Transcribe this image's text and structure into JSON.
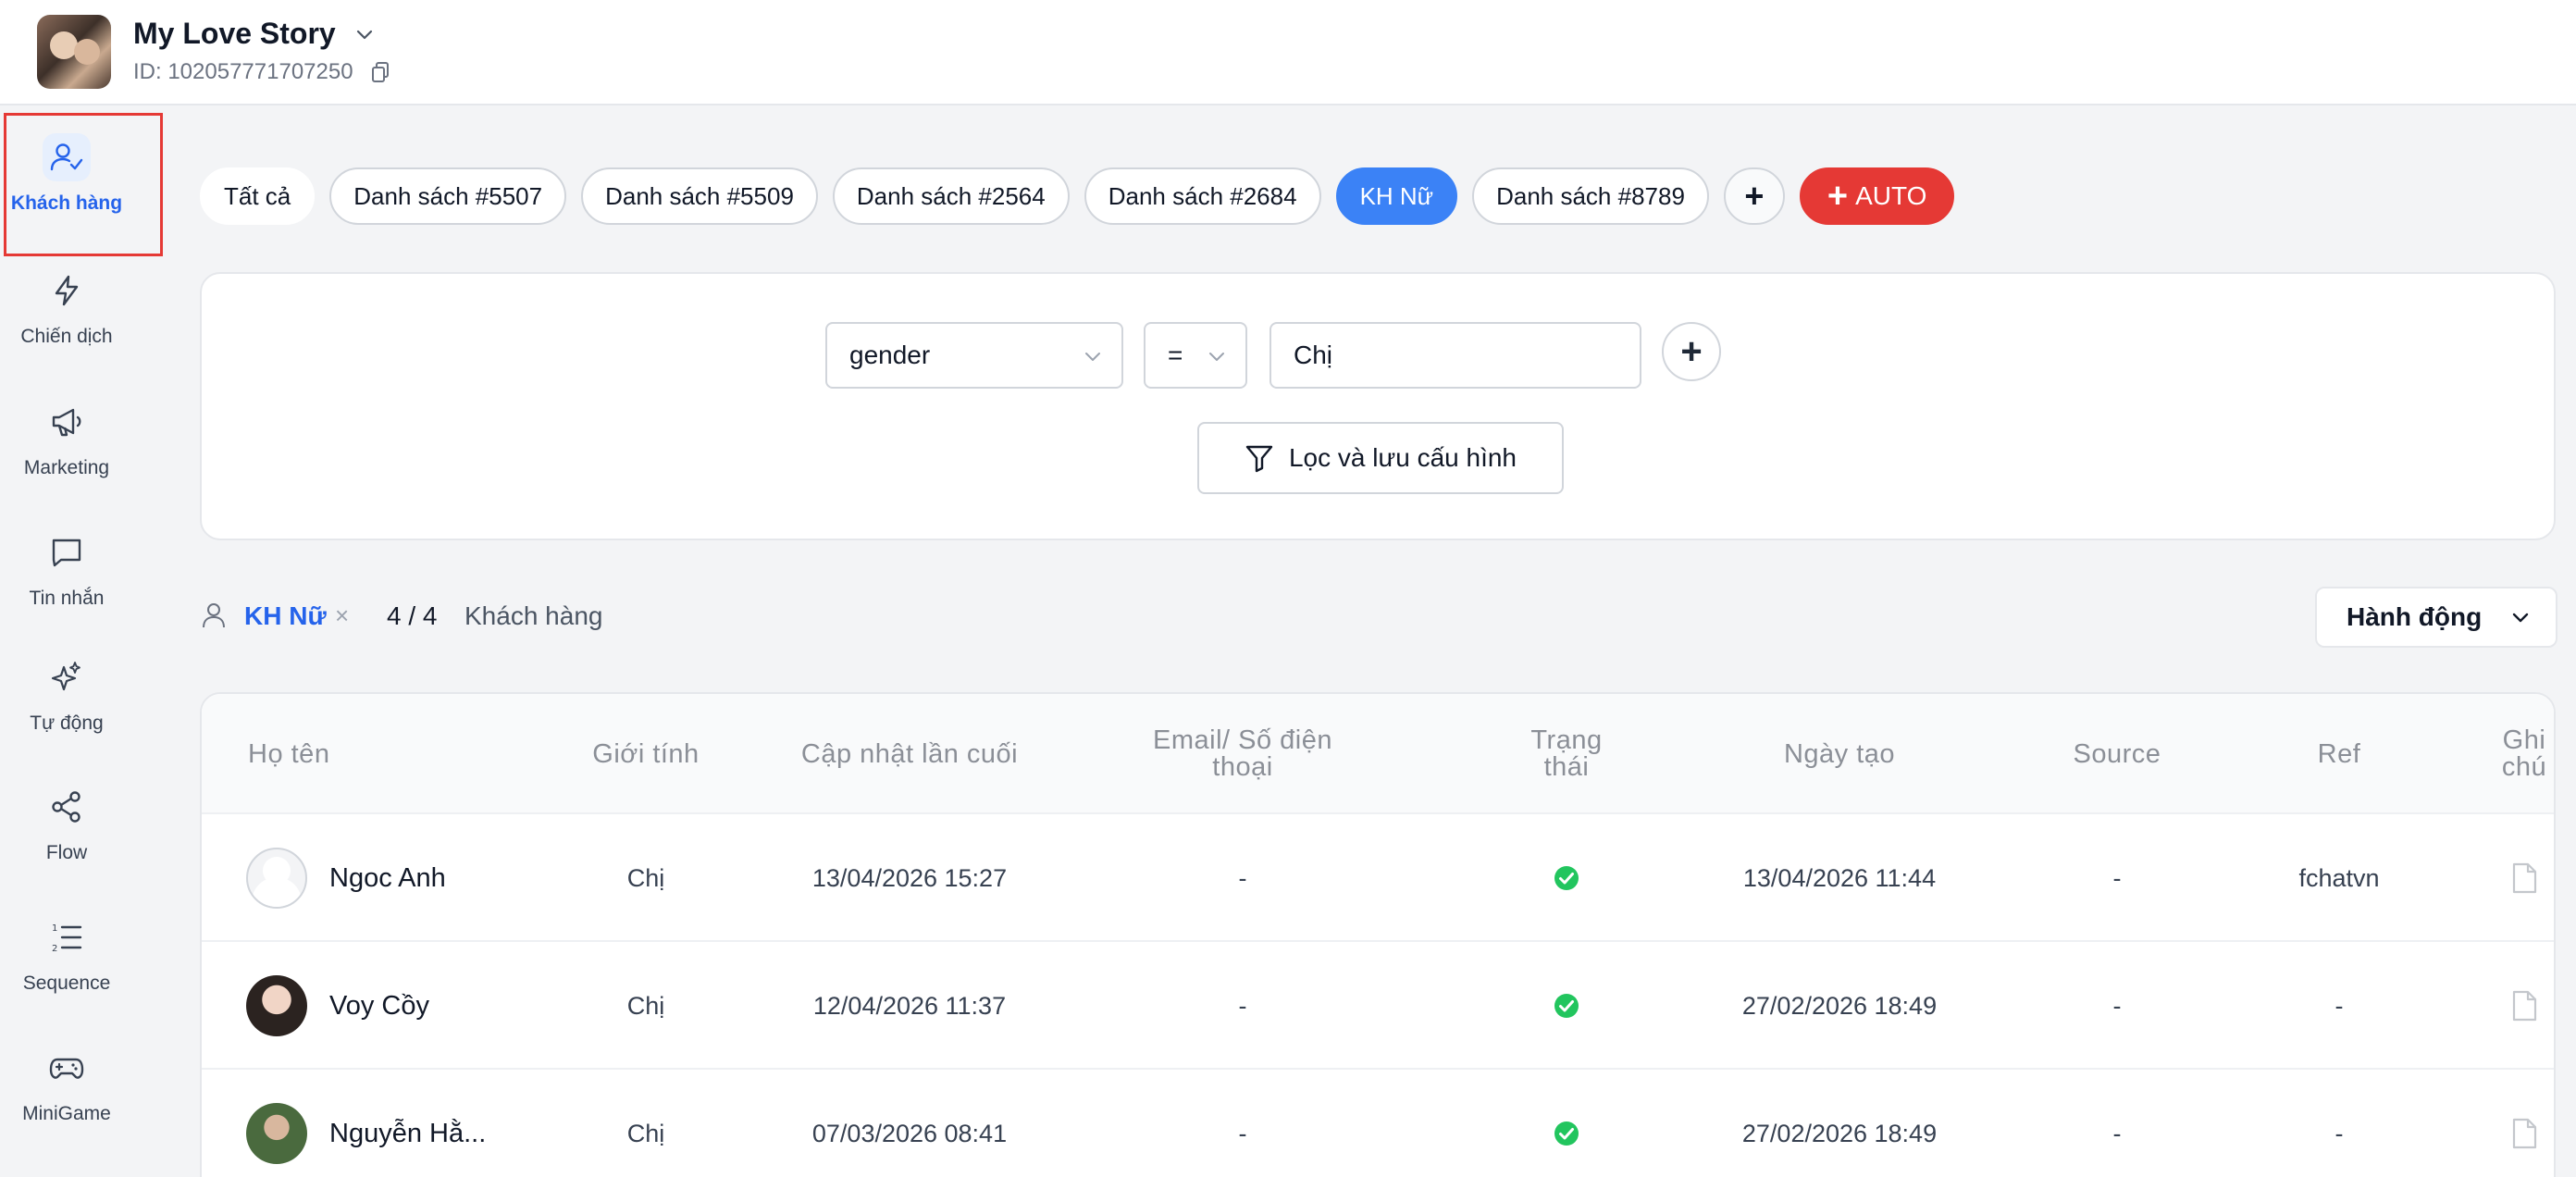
{
  "header": {
    "title": "My Love Story",
    "page_id": "ID: 102057771707250"
  },
  "sidebar": {
    "items": [
      {
        "label": "Khách hàng",
        "icon": "user-check-icon",
        "active": true
      },
      {
        "label": "Chiến dịch",
        "icon": "lightning-icon"
      },
      {
        "label": "Marketing",
        "icon": "megaphone-icon"
      },
      {
        "label": "Tin nhắn",
        "icon": "message-icon"
      },
      {
        "label": "Tự động",
        "icon": "sparkles-icon"
      },
      {
        "label": "Flow",
        "icon": "share-icon"
      },
      {
        "label": "Sequence",
        "icon": "numbered-list-icon"
      },
      {
        "label": "MiniGame",
        "icon": "gamepad-icon"
      }
    ]
  },
  "tabs": [
    {
      "label": "Tất cả"
    },
    {
      "label": "Danh sách #5507"
    },
    {
      "label": "Danh sách #5509"
    },
    {
      "label": "Danh sách #2564"
    },
    {
      "label": "Danh sách #2684"
    },
    {
      "label": "KH Nữ",
      "active": true
    },
    {
      "label": "Danh sách #8789"
    }
  ],
  "tab_add": "+",
  "auto_button": {
    "plus": "+",
    "label": "AUTO"
  },
  "filter": {
    "field": "gender",
    "operator": "=",
    "value": "Chị",
    "add": "+",
    "apply_label": "Lọc và lưu cấu hình"
  },
  "summary": {
    "segment": "KH Nữ",
    "close": "×",
    "count": "4 /  4",
    "count_label": "Khách hàng",
    "action_label": "Hành động"
  },
  "table": {
    "headers": {
      "name": "Họ tên",
      "gender": "Giới tính",
      "updated": "Cập nhật lần cuối",
      "contact_1": "Email/ Số điện",
      "contact_2": "thoại",
      "status_1": "Trạng",
      "status_2": "thái",
      "created": "Ngày tạo",
      "source": "Source",
      "ref": "Ref",
      "note_1": "Ghi",
      "note_2": "chú"
    },
    "rows": [
      {
        "name": "Ngoc Anh",
        "gender": "Chị",
        "updated": "13/04/2026 15:27",
        "contact": "-",
        "created": "13/04/2026 11:44",
        "source": "-",
        "ref": "fchatvn",
        "more": "•••"
      },
      {
        "name": "Voy Cồy",
        "gender": "Chị",
        "updated": "12/04/2026 11:37",
        "contact": "-",
        "created": "27/02/2026 18:49",
        "source": "-",
        "ref": "-",
        "more": "•••"
      },
      {
        "name": "Nguyễn Hằ...",
        "gender": "Chị",
        "updated": "07/03/2026 08:41",
        "contact": "-",
        "created": "27/02/2026 18:49",
        "source": "-",
        "ref": "-",
        "more": "•••"
      }
    ]
  },
  "colors": {
    "accent": "#3b82f6",
    "auto": "#e53935",
    "status_ok": "#22c55e",
    "highlight_border": "#e53935"
  }
}
